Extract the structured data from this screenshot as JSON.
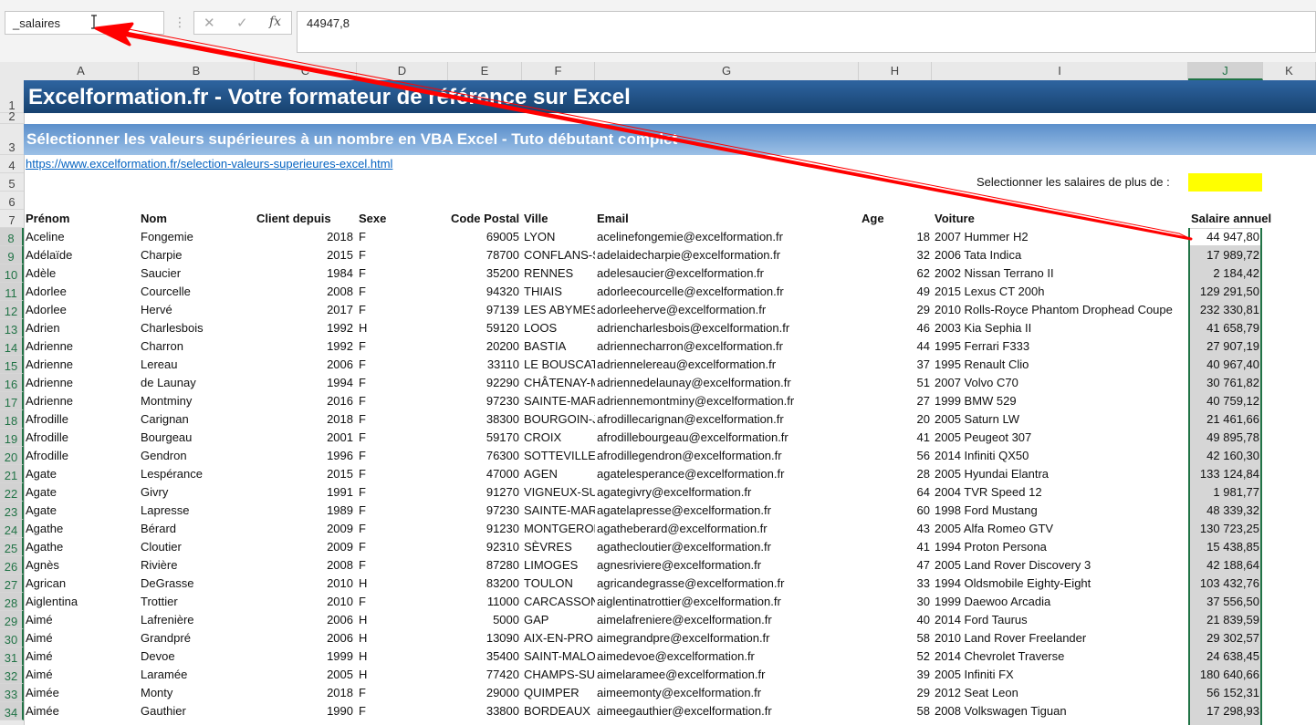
{
  "formula_bar": {
    "name_box": "_salaires",
    "cancel_icon": "✕",
    "enter_icon": "✓",
    "fx_label": "fx",
    "formula_value": "44947,8"
  },
  "columns": [
    "A",
    "B",
    "C",
    "D",
    "E",
    "F",
    "G",
    "H",
    "I",
    "J",
    "K"
  ],
  "row_numbers": [
    "1",
    "2",
    "3",
    "4",
    "5",
    "6",
    "7",
    "8",
    "9",
    "10",
    "11",
    "12",
    "13",
    "14",
    "15",
    "16",
    "17",
    "18",
    "19",
    "20",
    "21",
    "22",
    "23",
    "24",
    "25",
    "26",
    "27",
    "28",
    "29",
    "30",
    "31",
    "32",
    "33",
    "34"
  ],
  "sheet": {
    "banner_title": "Excelformation.fr - Votre formateur de référence sur Excel",
    "banner_subtitle": "Sélectionner les valeurs supérieures à un nombre en VBA Excel - Tuto débutant complet",
    "link": "https://www.excelformation.fr/selection-valeurs-superieures-excel.html",
    "select_label": "Selectionner les salaires de plus de :",
    "headers": {
      "prenom": "Prénom",
      "nom": "Nom",
      "client": "Client depuis",
      "sexe": "Sexe",
      "cp": "Code Postal",
      "ville": "Ville",
      "email": "Email",
      "age": "Age",
      "voiture": "Voiture",
      "salaire": "Salaire annuel"
    },
    "rows": [
      [
        "Aceline",
        "Fongemie",
        "2018",
        "F",
        "69005",
        "LYON",
        "acelinefongemie@excelformation.fr",
        "18",
        "2007 Hummer H2",
        "44 947,80"
      ],
      [
        "Adélaïde",
        "Charpie",
        "2015",
        "F",
        "78700",
        "CONFLANS-S",
        "adelaidecharpie@excelformation.fr",
        "32",
        "2006 Tata Indica",
        "17 989,72"
      ],
      [
        "Adèle",
        "Saucier",
        "1984",
        "F",
        "35200",
        "RENNES",
        "adelesaucier@excelformation.fr",
        "62",
        "2002 Nissan Terrano II",
        "2 184,42"
      ],
      [
        "Adorlee",
        "Courcelle",
        "2008",
        "F",
        "94320",
        "THIAIS",
        "adorleecourcelle@excelformation.fr",
        "49",
        "2015 Lexus CT 200h",
        "129 291,50"
      ],
      [
        "Adorlee",
        "Hervé",
        "2017",
        "F",
        "97139",
        "LES ABYMES",
        "adorleeherve@excelformation.fr",
        "29",
        "2010 Rolls-Royce Phantom Drophead Coupe",
        "232 330,81"
      ],
      [
        "Adrien",
        "Charlesbois",
        "1992",
        "H",
        "59120",
        "LOOS",
        "adriencharlesbois@excelformation.fr",
        "46",
        "2003 Kia Sephia II",
        "41 658,79"
      ],
      [
        "Adrienne",
        "Charron",
        "1992",
        "F",
        "20200",
        "BASTIA",
        "adriennecharron@excelformation.fr",
        "44",
        "1995 Ferrari F333",
        "27 907,19"
      ],
      [
        "Adrienne",
        "Lereau",
        "2006",
        "F",
        "33110",
        "LE BOUSCAT",
        "adriennelereau@excelformation.fr",
        "37",
        "1995 Renault Clio",
        "40 967,40"
      ],
      [
        "Adrienne",
        "de Launay",
        "1994",
        "F",
        "92290",
        "CHÂTENAY-M",
        "adriennedelaunay@excelformation.fr",
        "51",
        "2007 Volvo C70",
        "30 761,82"
      ],
      [
        "Adrienne",
        "Montminy",
        "2016",
        "F",
        "97230",
        "SAINTE-MAR",
        "adriennemontminy@excelformation.fr",
        "27",
        "1999 BMW 529",
        "40 759,12"
      ],
      [
        "Afrodille",
        "Carignan",
        "2018",
        "F",
        "38300",
        "BOURGOIN-J",
        "afrodillecarignan@excelformation.fr",
        "20",
        "2005 Saturn LW",
        "21 461,66"
      ],
      [
        "Afrodille",
        "Bourgeau",
        "2001",
        "F",
        "59170",
        "CROIX",
        "afrodillebourgeau@excelformation.fr",
        "41",
        "2005 Peugeot 307",
        "49 895,78"
      ],
      [
        "Afrodille",
        "Gendron",
        "1996",
        "F",
        "76300",
        "SOTTEVILLE-L",
        "afrodillegendron@excelformation.fr",
        "56",
        "2014 Infiniti QX50",
        "42 160,30"
      ],
      [
        "Agate",
        "Lespérance",
        "2015",
        "F",
        "47000",
        "AGEN",
        "agatelesperance@excelformation.fr",
        "28",
        "2005 Hyundai Elantra",
        "133 124,84"
      ],
      [
        "Agate",
        "Givry",
        "1991",
        "F",
        "91270",
        "VIGNEUX-SU",
        "agategivry@excelformation.fr",
        "64",
        "2004 TVR Speed 12",
        "1 981,77"
      ],
      [
        "Agate",
        "Lapresse",
        "1989",
        "F",
        "97230",
        "SAINTE-MAR",
        "agatelapresse@excelformation.fr",
        "60",
        "1998 Ford Mustang",
        "48 339,32"
      ],
      [
        "Agathe",
        "Bérard",
        "2009",
        "F",
        "91230",
        "MONTGERON",
        "agatheberard@excelformation.fr",
        "43",
        "2005 Alfa Romeo GTV",
        "130 723,25"
      ],
      [
        "Agathe",
        "Cloutier",
        "2009",
        "F",
        "92310",
        "SÈVRES",
        "agathecloutier@excelformation.fr",
        "41",
        "1994 Proton Persona",
        "15 438,85"
      ],
      [
        "Agnès",
        "Rivière",
        "2008",
        "F",
        "87280",
        "LIMOGES",
        "agnesriviere@excelformation.fr",
        "47",
        "2005 Land Rover Discovery 3",
        "42 188,64"
      ],
      [
        "Agrican",
        "DeGrasse",
        "2010",
        "H",
        "83200",
        "TOULON",
        "agricandegrasse@excelformation.fr",
        "33",
        "1994 Oldsmobile Eighty-Eight",
        "103 432,76"
      ],
      [
        "Aiglentina",
        "Trottier",
        "2010",
        "F",
        "11000",
        "CARCASSON",
        "aiglentinatrottier@excelformation.fr",
        "30",
        "1999 Daewoo Arcadia",
        "37 556,50"
      ],
      [
        "Aimé",
        "Lafrenière",
        "2006",
        "H",
        "5000",
        "GAP",
        "aimelafreniere@excelformation.fr",
        "40",
        "2014 Ford Taurus",
        "21 839,59"
      ],
      [
        "Aimé",
        "Grandpré",
        "2006",
        "H",
        "13090",
        "AIX-EN-PRO",
        "aimegrandpre@excelformation.fr",
        "58",
        "2010 Land Rover Freelander",
        "29 302,57"
      ],
      [
        "Aimé",
        "Devoe",
        "1999",
        "H",
        "35400",
        "SAINT-MALO",
        "aimedevoe@excelformation.fr",
        "52",
        "2014 Chevrolet Traverse",
        "24 638,45"
      ],
      [
        "Aimé",
        "Laramée",
        "2005",
        "H",
        "77420",
        "CHAMPS-SUI",
        "aimelaramee@excelformation.fr",
        "39",
        "2005 Infiniti FX",
        "180 640,66"
      ],
      [
        "Aimée",
        "Monty",
        "2018",
        "F",
        "29000",
        "QUIMPER",
        "aimeemonty@excelformation.fr",
        "29",
        "2012 Seat Leon",
        "56 152,31"
      ],
      [
        "Aimée",
        "Gauthier",
        "1990",
        "F",
        "33800",
        "BORDEAUX",
        "aimeegauthier@excelformation.fr",
        "58",
        "2008 Volkswagen Tiguan",
        "17 298,93"
      ]
    ]
  },
  "colors": {
    "banner_dark": "#1f4e84",
    "banner_light": "#7aa6d8",
    "selection": "#217346",
    "highlight": "#ffff00",
    "arrow": "#ff0000"
  },
  "icons": {
    "cursor": "i-beam-cursor-icon",
    "arrow": "red-arrow-annotation"
  }
}
